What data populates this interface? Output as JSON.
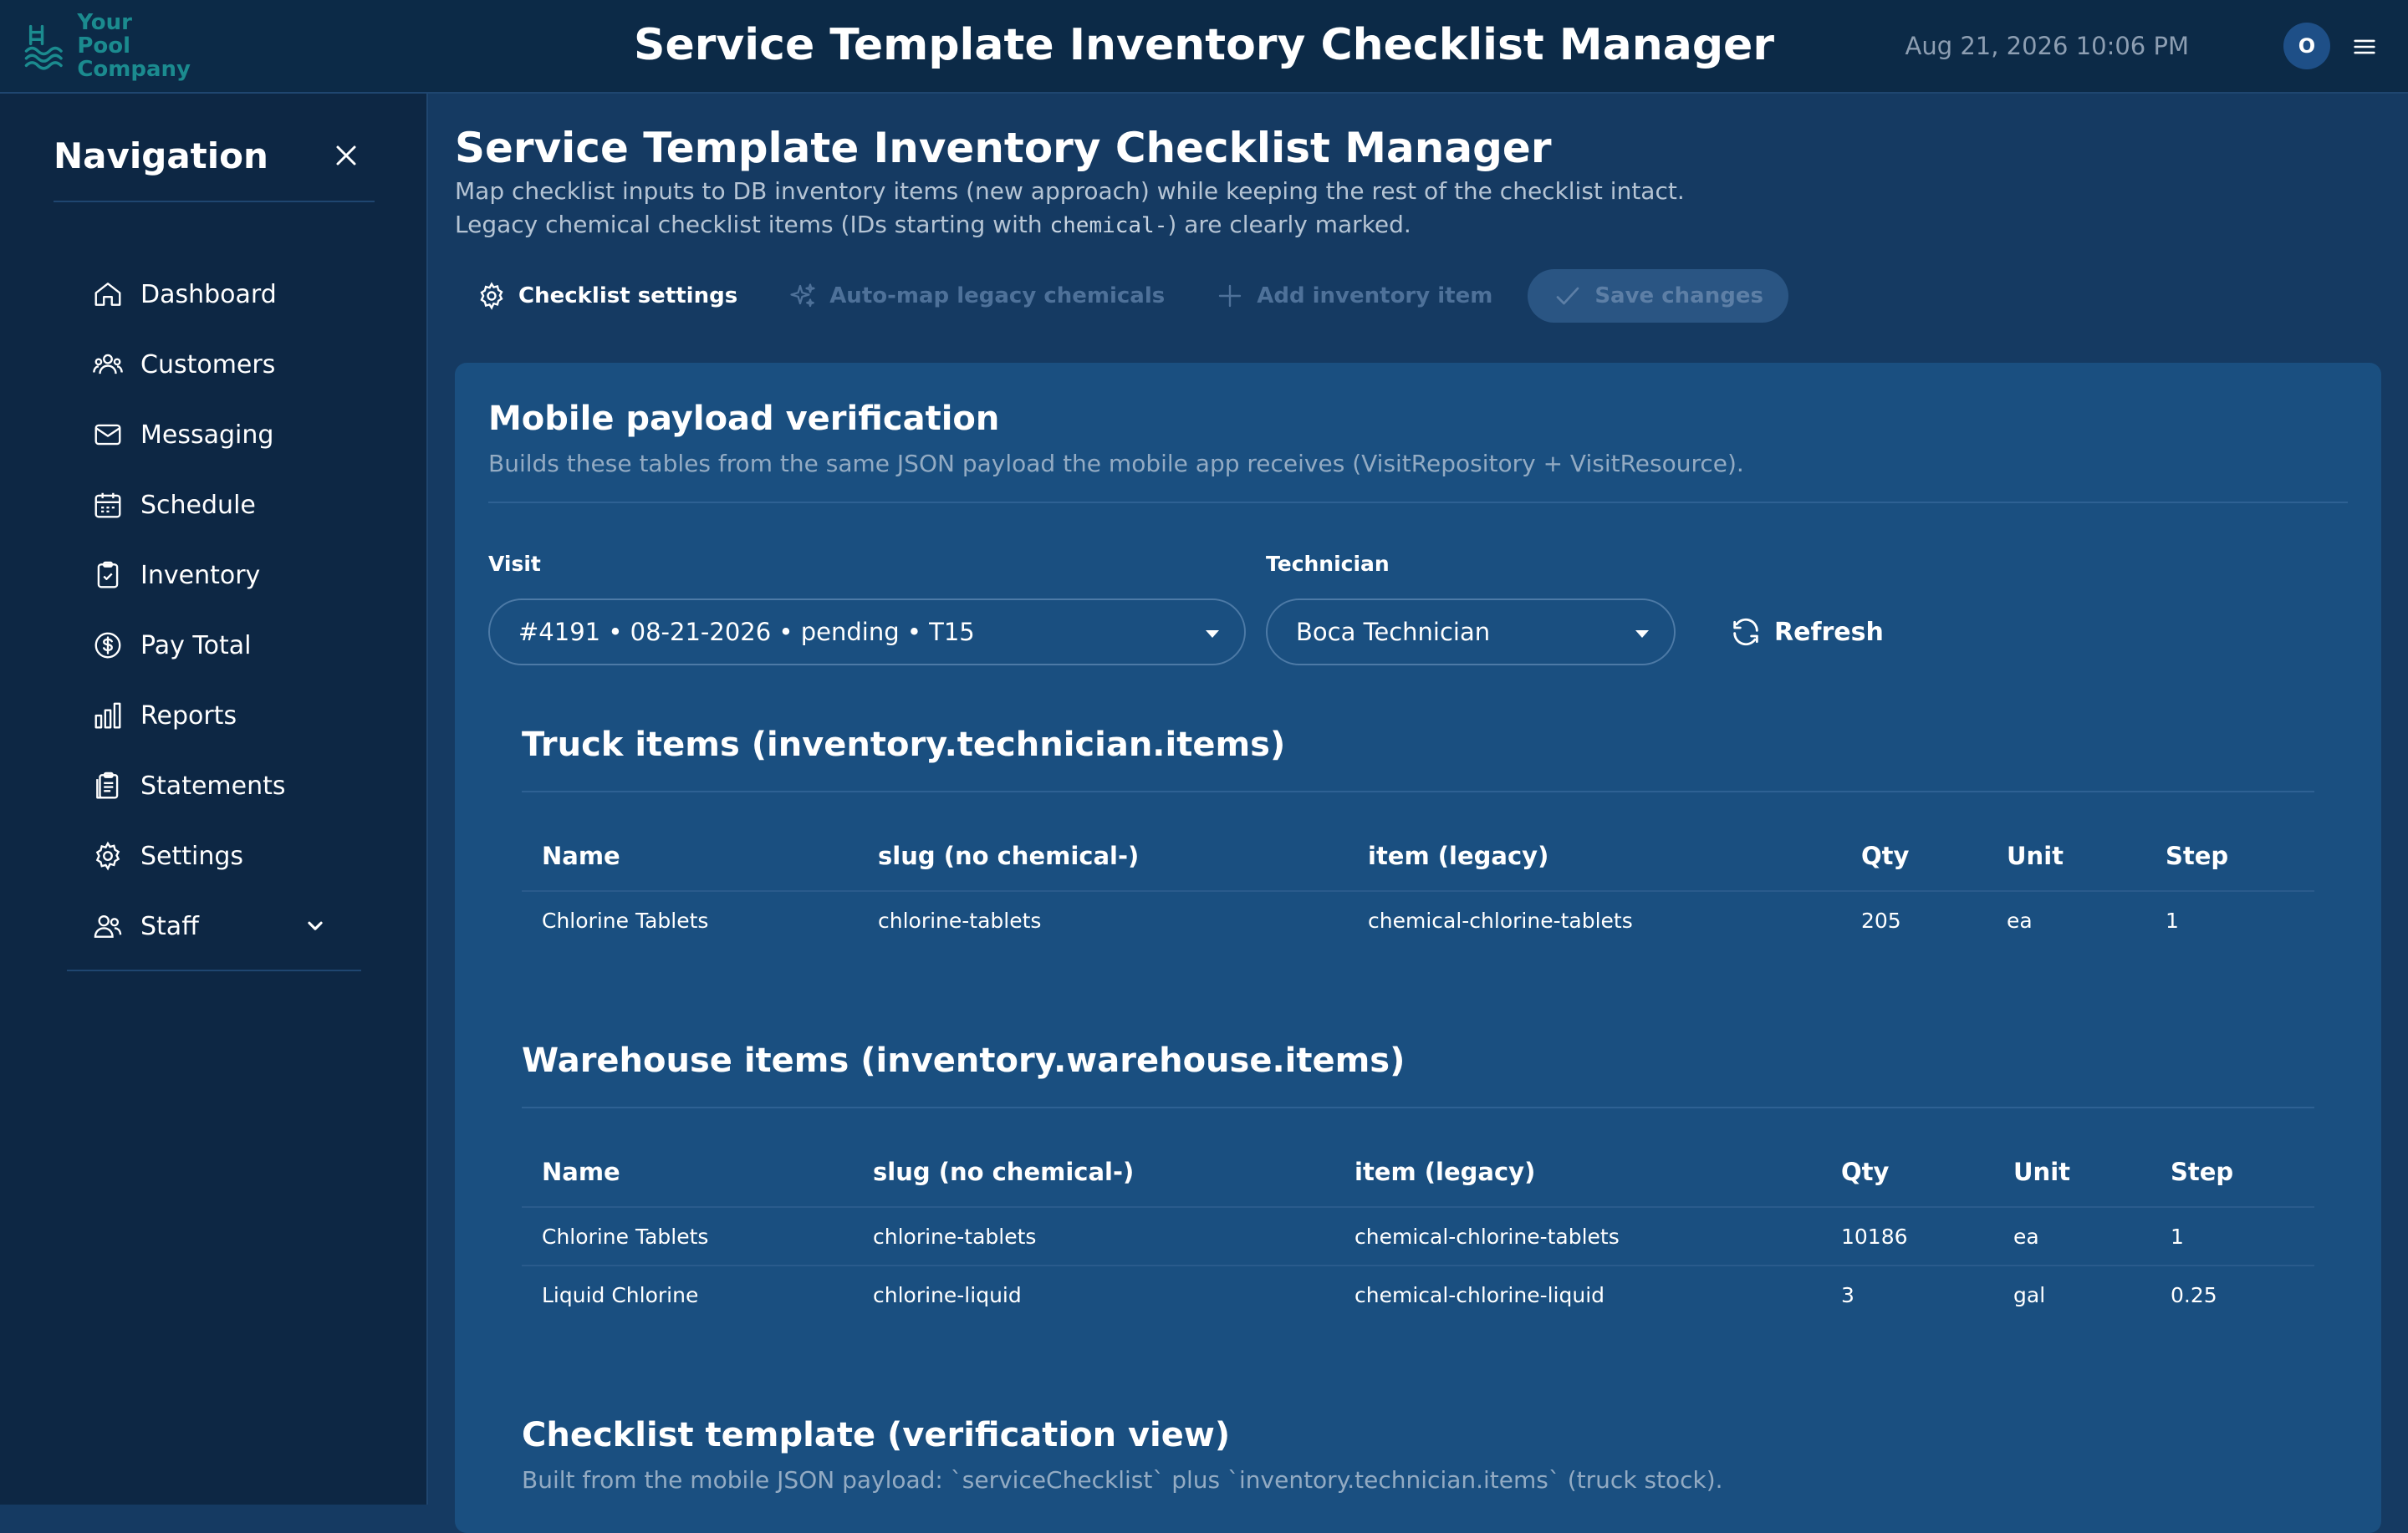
{
  "header": {
    "logo_line1": "Your Pool",
    "logo_line2": "Company",
    "title": "Service Template Inventory Checklist Manager",
    "datetime": "Aug 21, 2026 10:06 PM",
    "avatar_initial": "O"
  },
  "sidebar": {
    "title": "Navigation",
    "items": [
      {
        "label": "Dashboard",
        "icon": "home-icon"
      },
      {
        "label": "Customers",
        "icon": "users-icon"
      },
      {
        "label": "Messaging",
        "icon": "mail-icon"
      },
      {
        "label": "Schedule",
        "icon": "calendar-icon"
      },
      {
        "label": "Inventory",
        "icon": "clipboard-check-icon"
      },
      {
        "label": "Pay Total",
        "icon": "dollar-circle-icon"
      },
      {
        "label": "Reports",
        "icon": "bar-chart-icon"
      },
      {
        "label": "Statements",
        "icon": "documents-icon"
      },
      {
        "label": "Settings",
        "icon": "gear-icon"
      },
      {
        "label": "Staff",
        "icon": "staff-icon"
      }
    ]
  },
  "page": {
    "title": "Service Template Inventory Checklist Manager",
    "description1": "Map checklist inputs to DB inventory items (new approach) while keeping the rest of the checklist intact.",
    "description2_prefix": "Legacy chemical checklist items (IDs starting with ",
    "description2_code": "chemical-",
    "description2_suffix": ") are clearly marked."
  },
  "toolbar": {
    "checklist_settings": "Checklist settings",
    "auto_map": "Auto-map legacy chemicals",
    "add_item": "Add inventory item",
    "save": "Save changes"
  },
  "payload": {
    "title": "Mobile payload verification",
    "subtitle": "Builds these tables from the same JSON payload the mobile app receives (VisitRepository + VisitResource).",
    "visit_label": "Visit",
    "visit_value": "#4191 • 08-21-2026 • pending • T15",
    "technician_label": "Technician",
    "technician_value": "Boca Technician",
    "refresh": "Refresh"
  },
  "truck": {
    "title": "Truck items (inventory.technician.items)",
    "columns": [
      "Name",
      "slug (no chemical-)",
      "item (legacy)",
      "Qty",
      "Unit",
      "Step"
    ],
    "rows": [
      [
        "Chlorine Tablets",
        "chlorine-tablets",
        "chemical-chlorine-tablets",
        "205",
        "ea",
        "1"
      ]
    ]
  },
  "warehouse": {
    "title": "Warehouse items (inventory.warehouse.items)",
    "columns": [
      "Name",
      "slug (no chemical-)",
      "item (legacy)",
      "Qty",
      "Unit",
      "Step"
    ],
    "rows": [
      [
        "Chlorine Tablets",
        "chlorine-tablets",
        "chemical-chlorine-tablets",
        "10186",
        "ea",
        "1"
      ],
      [
        "Liquid Chlorine",
        "chlorine-liquid",
        "chemical-chlorine-liquid",
        "3",
        "gal",
        "0.25"
      ]
    ]
  },
  "checklist": {
    "title": "Checklist template (verification view)",
    "subtitle": "Built from the mobile JSON payload: `serviceChecklist` plus `inventory.technician.items` (truck stock)."
  },
  "colors": {
    "topbar": "#0c2a47",
    "sidebar": "#0d2744",
    "main_bg": "#153a62",
    "card_bg": "#1a4f80",
    "logo": "#1b8b8f"
  }
}
